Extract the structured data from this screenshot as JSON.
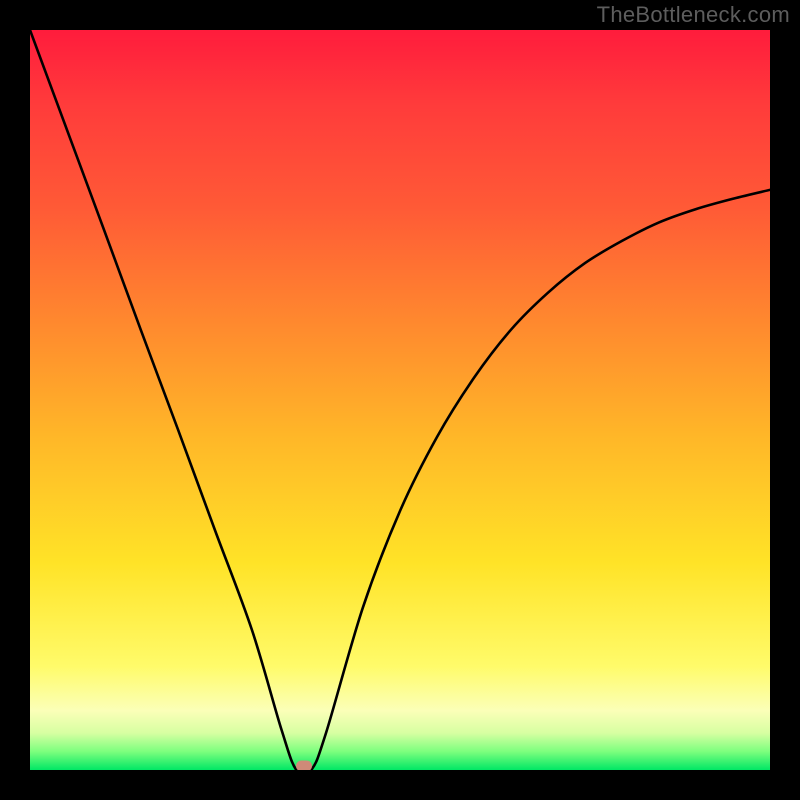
{
  "watermark_text": "TheBottleneck.com",
  "chart_data": {
    "type": "line",
    "title": "",
    "xlabel": "",
    "ylabel": "",
    "xlim": [
      0,
      1
    ],
    "ylim": [
      0,
      100
    ],
    "series": [
      {
        "name": "curve",
        "x": [
          0.0,
          0.05,
          0.1,
          0.15,
          0.2,
          0.25,
          0.3,
          0.34,
          0.36,
          0.38,
          0.4,
          0.45,
          0.5,
          0.55,
          0.6,
          0.65,
          0.7,
          0.75,
          0.8,
          0.85,
          0.9,
          0.95,
          1.0
        ],
        "values": [
          100.0,
          86.5,
          73.0,
          59.4,
          46.0,
          32.4,
          18.9,
          5.4,
          0.0,
          0.0,
          5.0,
          22.0,
          35.0,
          45.0,
          53.0,
          59.5,
          64.5,
          68.5,
          71.5,
          74.0,
          75.8,
          77.2,
          78.4
        ]
      }
    ],
    "marker": {
      "x": 0.37,
      "y": 0,
      "color": "#cf8a78"
    },
    "background_gradient": {
      "top": "#ff1c3c",
      "mid1": "#ff8a2e",
      "mid2": "#ffe327",
      "bottom": "#00e765"
    },
    "grid": false
  }
}
